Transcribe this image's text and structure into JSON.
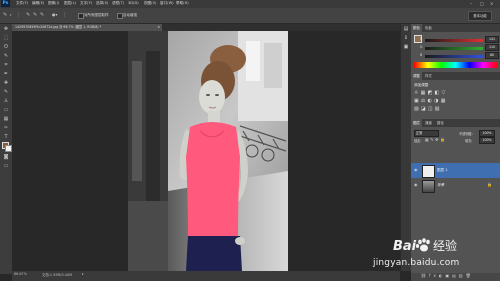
{
  "app": {
    "logo": "Ps"
  },
  "menubar": {
    "items": [
      "文件(F)",
      "编辑(E)",
      "图像(I)",
      "图层(L)",
      "文字(Y)",
      "选择(S)",
      "滤镜(T)",
      "3D(D)",
      "视图(V)",
      "窗口(W)",
      "帮助(H)"
    ],
    "window_controls": [
      "–",
      "□",
      "×"
    ]
  },
  "options_bar": {
    "sample_all_layers_label": "对所有图层取样",
    "auto_enhance_label": "自动增强",
    "workspace_button": "基本功能"
  },
  "document_tab": {
    "title": "1429970659f5c20672a.jpg @ 66.7% (图层 1, RGB/8) *",
    "close": "×"
  },
  "statusbar": {
    "zoom": "66.67%",
    "doc_info": "文档:1.59M/3.40M",
    "arrow": "▸"
  },
  "panels": {
    "color_tabs": [
      "颜色",
      "色板"
    ],
    "sliders": [
      {
        "label": "R",
        "value": "141",
        "color": "#e03030"
      },
      {
        "label": "G",
        "value": "110",
        "color": "#30b030"
      },
      {
        "label": "B",
        "value": "80",
        "color": "#3050e0"
      }
    ],
    "adjust_tabs": [
      "调整",
      "样式"
    ],
    "adjust_title": "添加调整",
    "layer_tabs": [
      "图层",
      "通道",
      "路径"
    ],
    "blend_mode": "正常",
    "opacity_label": "不透明度:",
    "opacity_value": "100%",
    "lock_label": "锁定:",
    "fill_label": "填充:",
    "fill_value": "100%",
    "layers": [
      {
        "name": "图层 1",
        "selected": true
      },
      {
        "name": "背景",
        "selected": false,
        "locked": true
      }
    ]
  },
  "watermark": {
    "brand_text": "Bai",
    "brand_text2": "经验",
    "url": "jingyan.baidu.com"
  }
}
